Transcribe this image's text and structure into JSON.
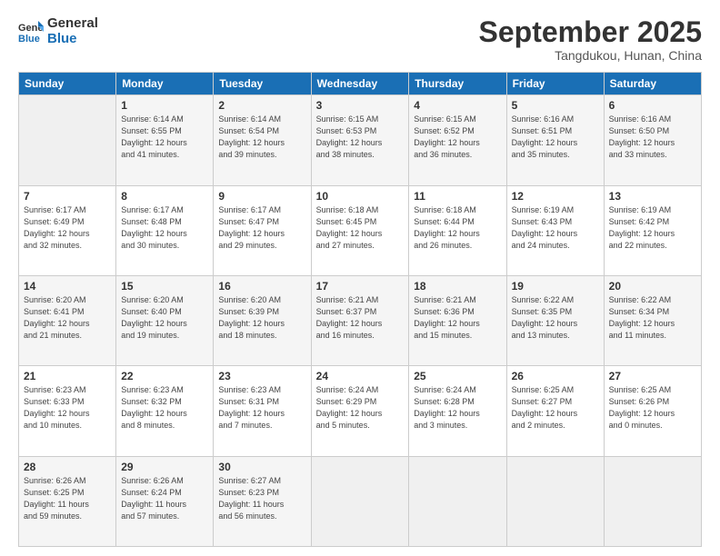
{
  "logo": {
    "line1": "General",
    "line2": "Blue"
  },
  "title": "September 2025",
  "subtitle": "Tangdukou, Hunan, China",
  "headers": [
    "Sunday",
    "Monday",
    "Tuesday",
    "Wednesday",
    "Thursday",
    "Friday",
    "Saturday"
  ],
  "weeks": [
    [
      {
        "day": "",
        "info": ""
      },
      {
        "day": "1",
        "info": "Sunrise: 6:14 AM\nSunset: 6:55 PM\nDaylight: 12 hours\nand 41 minutes."
      },
      {
        "day": "2",
        "info": "Sunrise: 6:14 AM\nSunset: 6:54 PM\nDaylight: 12 hours\nand 39 minutes."
      },
      {
        "day": "3",
        "info": "Sunrise: 6:15 AM\nSunset: 6:53 PM\nDaylight: 12 hours\nand 38 minutes."
      },
      {
        "day": "4",
        "info": "Sunrise: 6:15 AM\nSunset: 6:52 PM\nDaylight: 12 hours\nand 36 minutes."
      },
      {
        "day": "5",
        "info": "Sunrise: 6:16 AM\nSunset: 6:51 PM\nDaylight: 12 hours\nand 35 minutes."
      },
      {
        "day": "6",
        "info": "Sunrise: 6:16 AM\nSunset: 6:50 PM\nDaylight: 12 hours\nand 33 minutes."
      }
    ],
    [
      {
        "day": "7",
        "info": "Sunrise: 6:17 AM\nSunset: 6:49 PM\nDaylight: 12 hours\nand 32 minutes."
      },
      {
        "day": "8",
        "info": "Sunrise: 6:17 AM\nSunset: 6:48 PM\nDaylight: 12 hours\nand 30 minutes."
      },
      {
        "day": "9",
        "info": "Sunrise: 6:17 AM\nSunset: 6:47 PM\nDaylight: 12 hours\nand 29 minutes."
      },
      {
        "day": "10",
        "info": "Sunrise: 6:18 AM\nSunset: 6:45 PM\nDaylight: 12 hours\nand 27 minutes."
      },
      {
        "day": "11",
        "info": "Sunrise: 6:18 AM\nSunset: 6:44 PM\nDaylight: 12 hours\nand 26 minutes."
      },
      {
        "day": "12",
        "info": "Sunrise: 6:19 AM\nSunset: 6:43 PM\nDaylight: 12 hours\nand 24 minutes."
      },
      {
        "day": "13",
        "info": "Sunrise: 6:19 AM\nSunset: 6:42 PM\nDaylight: 12 hours\nand 22 minutes."
      }
    ],
    [
      {
        "day": "14",
        "info": "Sunrise: 6:20 AM\nSunset: 6:41 PM\nDaylight: 12 hours\nand 21 minutes."
      },
      {
        "day": "15",
        "info": "Sunrise: 6:20 AM\nSunset: 6:40 PM\nDaylight: 12 hours\nand 19 minutes."
      },
      {
        "day": "16",
        "info": "Sunrise: 6:20 AM\nSunset: 6:39 PM\nDaylight: 12 hours\nand 18 minutes."
      },
      {
        "day": "17",
        "info": "Sunrise: 6:21 AM\nSunset: 6:37 PM\nDaylight: 12 hours\nand 16 minutes."
      },
      {
        "day": "18",
        "info": "Sunrise: 6:21 AM\nSunset: 6:36 PM\nDaylight: 12 hours\nand 15 minutes."
      },
      {
        "day": "19",
        "info": "Sunrise: 6:22 AM\nSunset: 6:35 PM\nDaylight: 12 hours\nand 13 minutes."
      },
      {
        "day": "20",
        "info": "Sunrise: 6:22 AM\nSunset: 6:34 PM\nDaylight: 12 hours\nand 11 minutes."
      }
    ],
    [
      {
        "day": "21",
        "info": "Sunrise: 6:23 AM\nSunset: 6:33 PM\nDaylight: 12 hours\nand 10 minutes."
      },
      {
        "day": "22",
        "info": "Sunrise: 6:23 AM\nSunset: 6:32 PM\nDaylight: 12 hours\nand 8 minutes."
      },
      {
        "day": "23",
        "info": "Sunrise: 6:23 AM\nSunset: 6:31 PM\nDaylight: 12 hours\nand 7 minutes."
      },
      {
        "day": "24",
        "info": "Sunrise: 6:24 AM\nSunset: 6:29 PM\nDaylight: 12 hours\nand 5 minutes."
      },
      {
        "day": "25",
        "info": "Sunrise: 6:24 AM\nSunset: 6:28 PM\nDaylight: 12 hours\nand 3 minutes."
      },
      {
        "day": "26",
        "info": "Sunrise: 6:25 AM\nSunset: 6:27 PM\nDaylight: 12 hours\nand 2 minutes."
      },
      {
        "day": "27",
        "info": "Sunrise: 6:25 AM\nSunset: 6:26 PM\nDaylight: 12 hours\nand 0 minutes."
      }
    ],
    [
      {
        "day": "28",
        "info": "Sunrise: 6:26 AM\nSunset: 6:25 PM\nDaylight: 11 hours\nand 59 minutes."
      },
      {
        "day": "29",
        "info": "Sunrise: 6:26 AM\nSunset: 6:24 PM\nDaylight: 11 hours\nand 57 minutes."
      },
      {
        "day": "30",
        "info": "Sunrise: 6:27 AM\nSunset: 6:23 PM\nDaylight: 11 hours\nand 56 minutes."
      },
      {
        "day": "",
        "info": ""
      },
      {
        "day": "",
        "info": ""
      },
      {
        "day": "",
        "info": ""
      },
      {
        "day": "",
        "info": ""
      }
    ]
  ]
}
